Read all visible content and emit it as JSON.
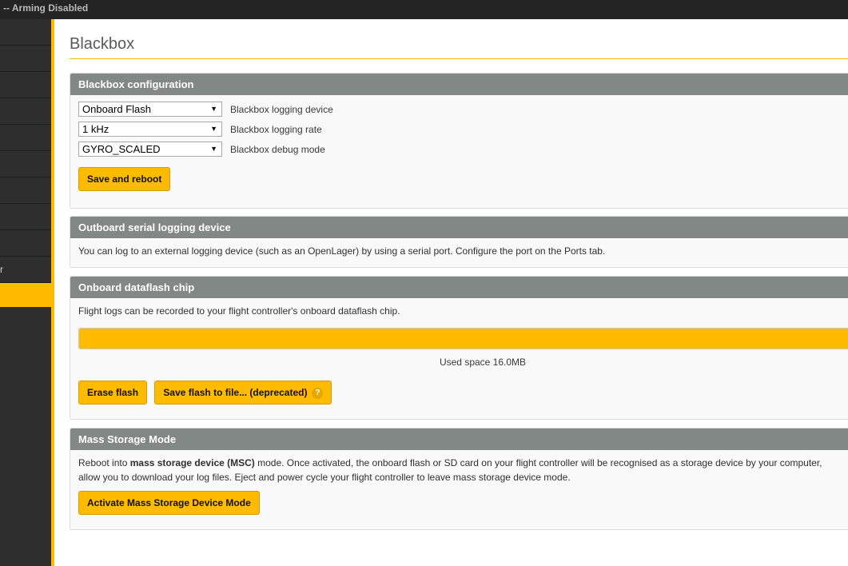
{
  "topbar": {
    "status": "-- Arming Disabled"
  },
  "sidebar": {
    "items": [
      "",
      "",
      "",
      "",
      "",
      "",
      "",
      "",
      "",
      "r",
      ""
    ],
    "active_index": 10
  },
  "page": {
    "title": "Blackbox"
  },
  "config": {
    "header": "Blackbox configuration",
    "device_value": "Onboard Flash",
    "device_label": "Blackbox logging device",
    "rate_value": "1 kHz",
    "rate_label": "Blackbox logging rate",
    "debug_value": "GYRO_SCALED",
    "debug_label": "Blackbox debug mode",
    "save_label": "Save and reboot"
  },
  "serial": {
    "header": "Outboard serial logging device",
    "text": "You can log to an external logging device (such as an OpenLager) by using a serial port. Configure the port on the Ports tab."
  },
  "dataflash": {
    "header": "Onboard dataflash chip",
    "text": "Flight logs can be recorded to your flight controller's onboard dataflash chip.",
    "used_fraction": 1.0,
    "used_label": "Used space 16.0MB",
    "erase_label": "Erase flash",
    "save_label": "Save flash to file... (deprecated)",
    "help_glyph": "?"
  },
  "msc": {
    "header": "Mass Storage Mode",
    "text_prefix": "Reboot into ",
    "text_bold": "mass storage device (MSC)",
    "text_suffix": " mode. Once activated, the onboard flash or SD card on your flight controller will be recognised as a storage device by your computer,",
    "text_line2": "allow you to download your log files. Eject and power cycle your flight controller to leave mass storage device mode.",
    "button_label": "Activate Mass Storage Device Mode"
  },
  "colors": {
    "accent": "#ffbb00",
    "header_bg": "#828885",
    "sidebar_bg": "#2e2e2e"
  }
}
